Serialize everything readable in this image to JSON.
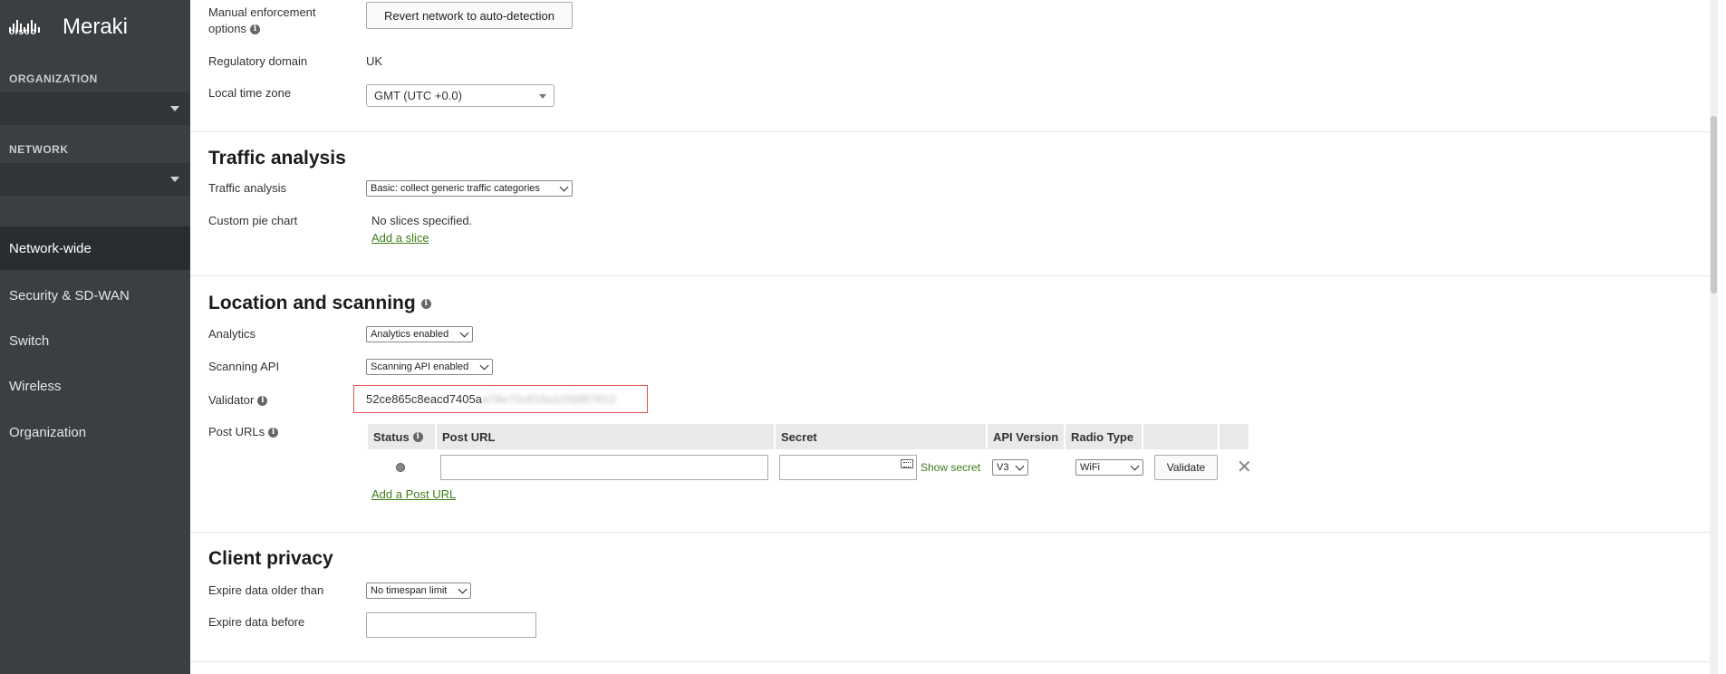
{
  "sidebar": {
    "logo": {
      "cisco": "cisco",
      "brand": "Meraki"
    },
    "organization_label": "ORGANIZATION",
    "organization_value": "",
    "network_label": "NETWORK",
    "network_value": "",
    "nav": [
      {
        "label": "Network-wide",
        "active": true
      },
      {
        "label": "Security & SD-WAN"
      },
      {
        "label": "Switch"
      },
      {
        "label": "Wireless"
      },
      {
        "label": "Organization"
      }
    ]
  },
  "general": {
    "manual_enforcement_label_1": "Manual enforcement",
    "manual_enforcement_label_2": "options",
    "revert_button": "Revert network to auto-detection",
    "regulatory_domain_label": "Regulatory domain",
    "regulatory_domain_value": "UK",
    "local_time_zone_label": "Local time zone",
    "local_time_zone_value": "GMT (UTC +0.0)"
  },
  "traffic_analysis": {
    "title": "Traffic analysis",
    "traffic_analysis_label": "Traffic analysis",
    "traffic_analysis_value": "Basic: collect generic traffic categories",
    "custom_pie_label": "Custom pie chart",
    "custom_pie_value": "No slices specified.",
    "add_slice_link": "Add a slice"
  },
  "location_scanning": {
    "title": "Location and scanning",
    "analytics_label": "Analytics",
    "analytics_value": "Analytics enabled",
    "scanning_api_label": "Scanning API",
    "scanning_api_value": "Scanning API enabled",
    "validator_label": "Validator",
    "validator_visible": "52ce865c8eacd7405a",
    "validator_blurred": "a78e70c816a105bf87810",
    "post_urls_label": "Post URLs",
    "table_headers": {
      "status": "Status",
      "post_url": "Post URL",
      "secret": "Secret",
      "api_version": "API Version",
      "radio_type": "Radio Type"
    },
    "row": {
      "post_url": "",
      "secret": "",
      "show_secret": "Show secret",
      "api_version": "V3",
      "radio_type": "WiFi",
      "validate_button": "Validate"
    },
    "add_post_url_link": "Add a Post URL"
  },
  "client_privacy": {
    "title": "Client privacy",
    "expire_older_label": "Expire data older than",
    "expire_older_value": "No timespan limit",
    "expire_before_label": "Expire data before",
    "expire_before_value": ""
  },
  "icons": {
    "info": "info-icon",
    "close": "close-icon",
    "keypad": "keypad-icon",
    "dropdown": "chevron-down-icon"
  },
  "colors": {
    "sidebar_bg": "#3c3f42",
    "link": "#3f7d1a",
    "validator_border": "#e05252"
  }
}
